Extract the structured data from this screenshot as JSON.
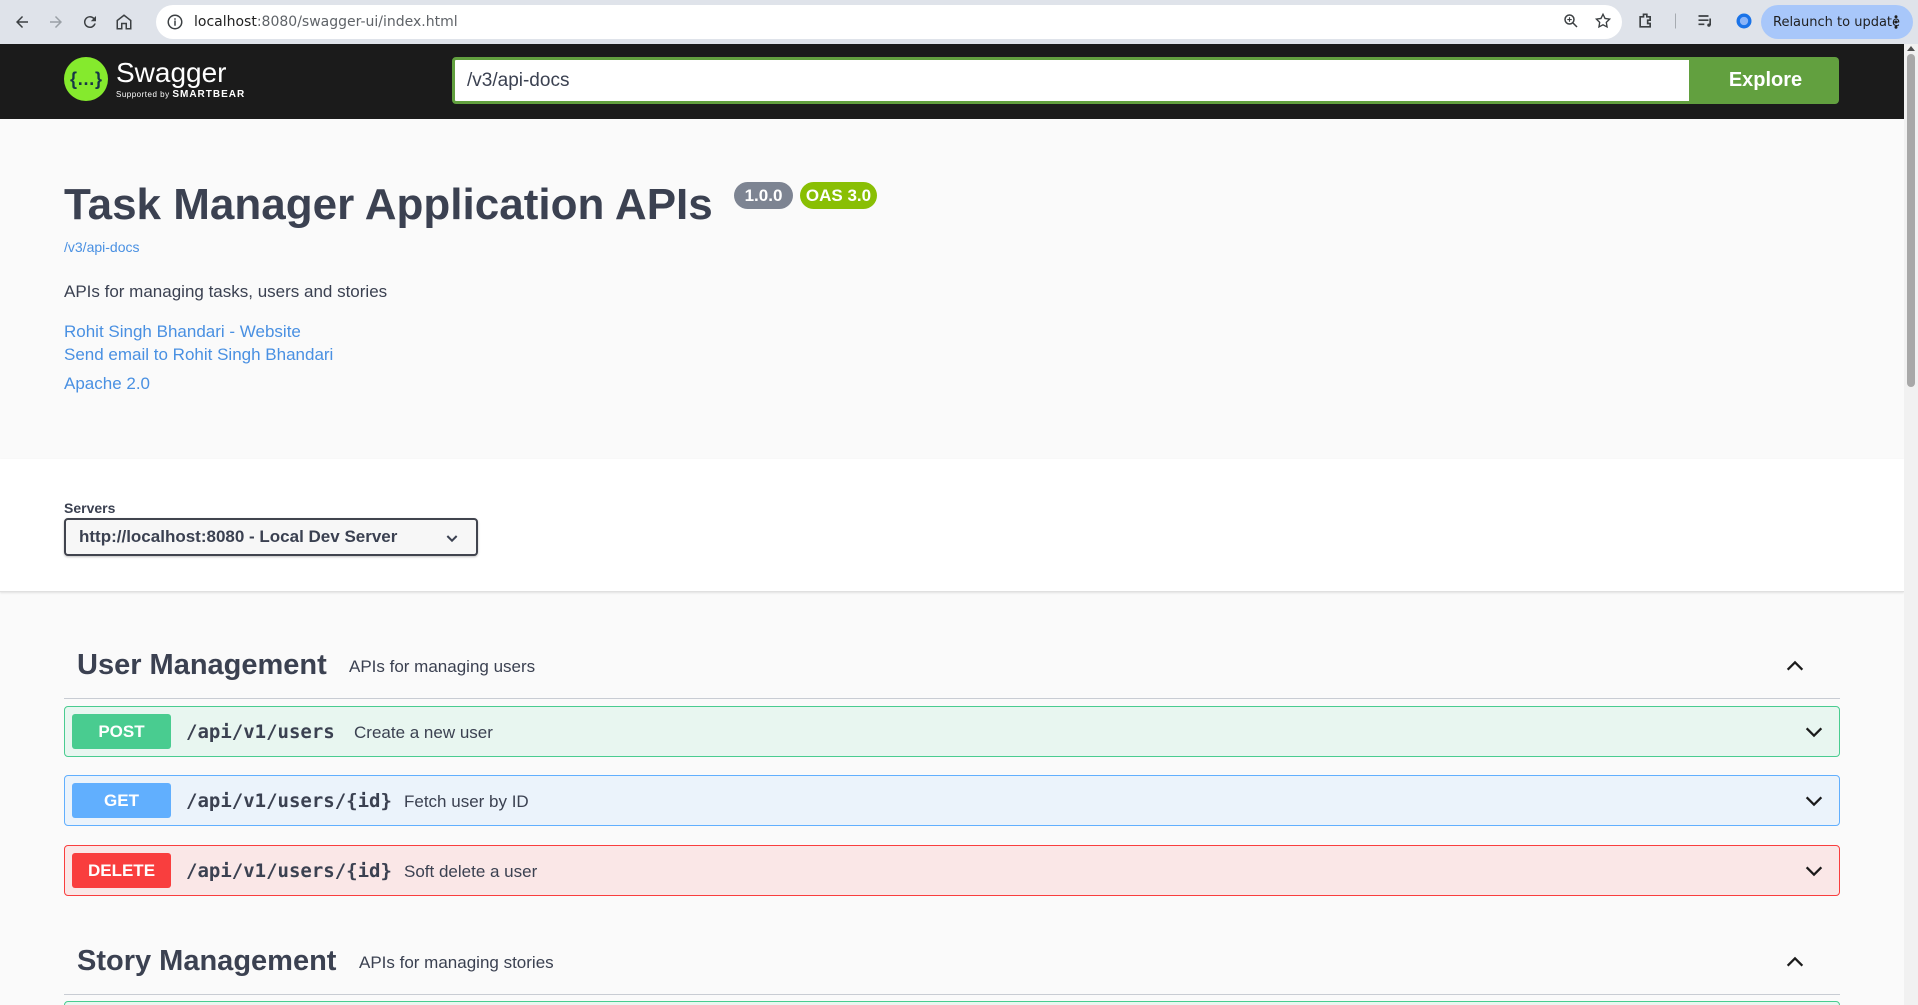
{
  "browser": {
    "url_host": "localhost",
    "url_rest": ":8080/swagger-ui/index.html",
    "relaunch_label": "Relaunch to update"
  },
  "topbar": {
    "logo_name": "Swagger",
    "logo_supported": "Supported by",
    "logo_brand": "SMARTBEAR",
    "spec_url": "/v3/api-docs",
    "explore_label": "Explore"
  },
  "info": {
    "title": "Task Manager Application APIs",
    "version": "1.0.0",
    "oas": "OAS 3.0",
    "spec_link": "/v3/api-docs",
    "description": "APIs for managing tasks, users and stories",
    "contact_website": "Rohit Singh Bhandari - Website",
    "contact_email": "Send email to Rohit Singh Bhandari",
    "license": "Apache 2.0"
  },
  "servers": {
    "label": "Servers",
    "selected": "http://localhost:8080 - Local Dev Server"
  },
  "tags": [
    {
      "name": "User Management",
      "description": "APIs for managing users",
      "operations": [
        {
          "method": "POST",
          "path": "/api/v1/users",
          "summary": "Create a new user"
        },
        {
          "method": "GET",
          "path": "/api/v1/users/{id}",
          "summary": "Fetch user by ID"
        },
        {
          "method": "DELETE",
          "path": "/api/v1/users/{id}",
          "summary": "Soft delete a user"
        }
      ]
    },
    {
      "name": "Story Management",
      "description": "APIs for managing stories",
      "operations": []
    }
  ],
  "colors": {
    "post": "#49cc90",
    "get": "#61affe",
    "delete": "#f93e3e",
    "explore": "#62a03f",
    "link": "#4990e2"
  }
}
